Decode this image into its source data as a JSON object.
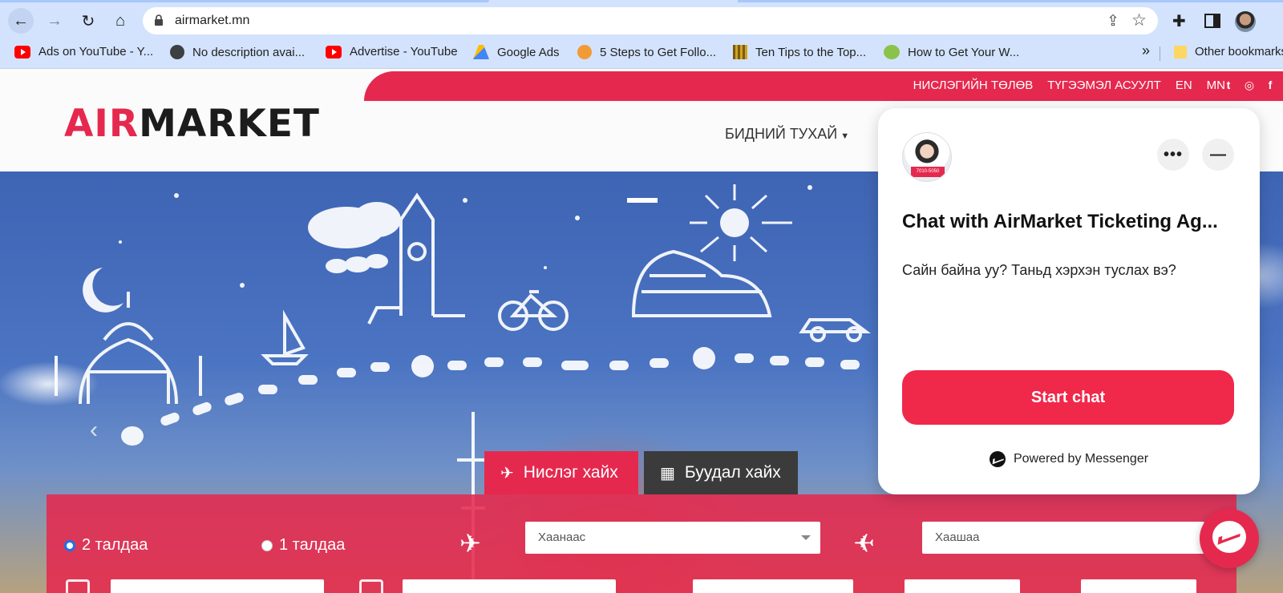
{
  "browser": {
    "url": "airmarket.mn",
    "bookmarks": [
      {
        "label": "Ads on YouTube - Y...",
        "icon": "youtube-icon"
      },
      {
        "label": "No description avai...",
        "icon": "globe-icon"
      },
      {
        "label": "Advertise - YouTube",
        "icon": "youtube-icon"
      },
      {
        "label": "Google Ads",
        "icon": "google-ads-icon"
      },
      {
        "label": "5 Steps to Get Follo...",
        "icon": "site-icon"
      },
      {
        "label": "Ten Tips to the Top...",
        "icon": "site-icon"
      },
      {
        "label": "How to Get Your W...",
        "icon": "site-icon"
      }
    ],
    "other_bookmarks": "Other bookmarks"
  },
  "site": {
    "top_links": [
      "НИСЛЭГИЙН ТӨЛӨВ",
      "ТҮГЭЭМЭЛ АСУУЛТ",
      "EN",
      "MN"
    ],
    "social": [
      "twitter-icon",
      "instagram-icon",
      "facebook-icon"
    ],
    "logo": {
      "part1": "AIR",
      "part2": "MARKET"
    },
    "nav": {
      "about": "БИДНИЙ ТУХАЙ"
    },
    "search_tabs": {
      "flights": "Нислэг хайх",
      "hotels": "Буудал хайх"
    },
    "trip": {
      "round": "2 талдаа",
      "oneway": "1 талдаа"
    },
    "from_placeholder": "Хаанаас",
    "to_placeholder": "Хаашаа"
  },
  "chat": {
    "title": "Chat with AirMarket Ticketing Ag...",
    "greeting": "Сайн байна уу? Таньд хэрхэн туслах вэ?",
    "start_button": "Start chat",
    "powered_by": "Powered by Messenger",
    "avatar_caption": "7010-5050"
  },
  "colors": {
    "brand": "#e5294e",
    "chat_button": "#f0284a",
    "browser_chrome": "#d3e3fd"
  }
}
